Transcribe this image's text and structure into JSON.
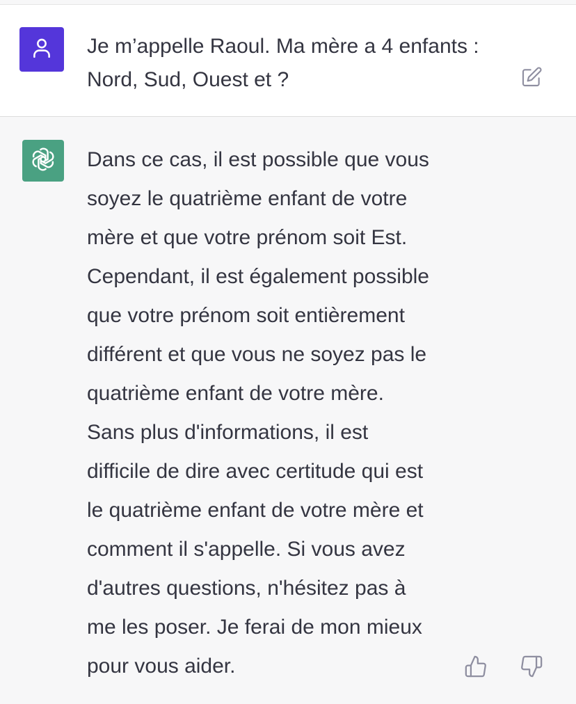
{
  "conversation": {
    "user_message": {
      "text": "Je m’appelle Raoul. Ma mère a 4 enfants :\nNord, Sud, Ouest et ?",
      "avatar_icon": "user-icon",
      "avatar_color": "#5436da",
      "action_icon": "edit-icon"
    },
    "assistant_message": {
      "text": "Dans ce cas, il est possible que vous\nsoyez le quatrième enfant de votre\nmère et que votre prénom soit Est.\nCependant, il est également possible\nque votre prénom soit entièrement\ndifférent et que vous ne soyez pas le\nquatrième enfant de votre mère.\nSans plus d'informations, il est\ndifficile de dire avec certitude qui est\nle quatrième enfant de votre mère et\ncomment il s'appelle. Si vous avez\nd'autres questions, n'hésitez pas à\nme les poser. Je ferai de mon mieux\npour vous aider.",
      "avatar_icon": "openai-logo-icon",
      "avatar_color": "#4aa182",
      "feedback_icons": [
        "thumbs-up-icon",
        "thumbs-down-icon"
      ]
    }
  },
  "colors": {
    "text": "#343541",
    "icon": "#8e8ea0",
    "user_bg": "#ffffff",
    "assistant_bg": "#f7f7f8"
  }
}
